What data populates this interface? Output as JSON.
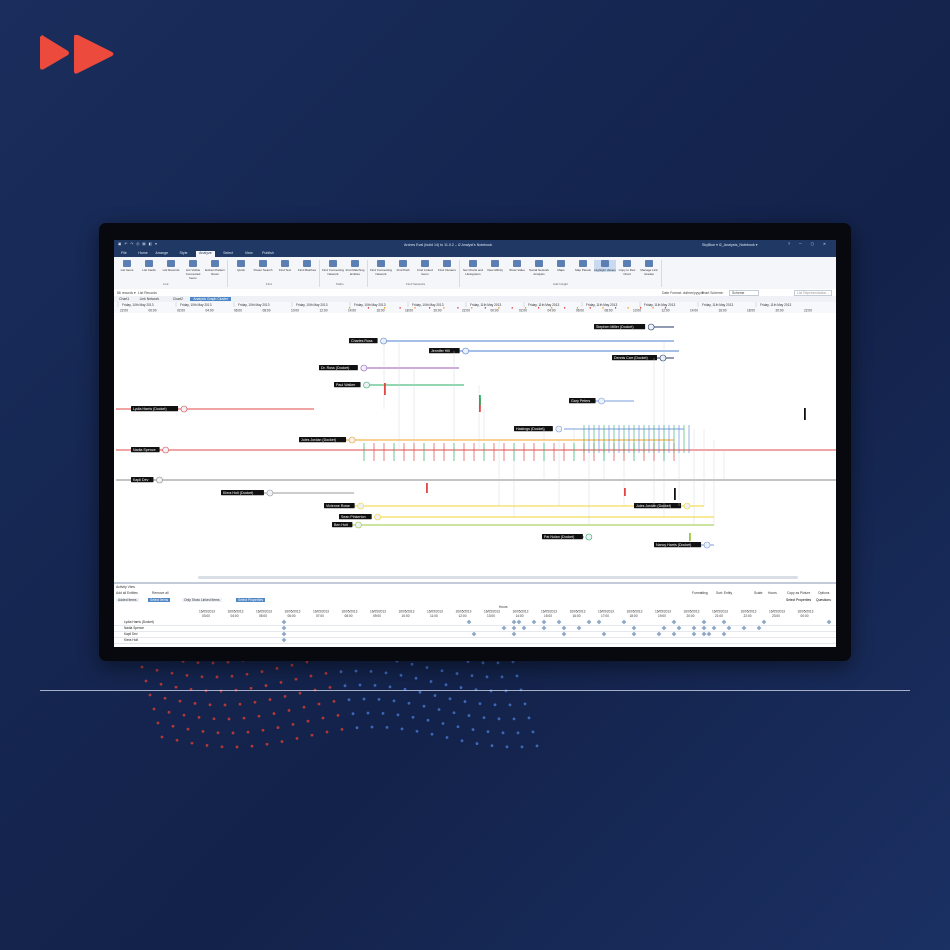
{
  "app": {
    "document_title": "Arches Eval (build 14) to 11.0.2 – i2 Analyst's Notebook",
    "user_area": "SkyBlue ▾ i2_Analysts_Notebook ▾",
    "qat_icons": [
      "save-icon",
      "undo-icon",
      "redo-icon",
      "print-icon"
    ],
    "menu": [
      "File",
      "Home",
      "Arrange",
      "Style",
      "Analyze",
      "Select",
      "View",
      "Publish"
    ],
    "active_menu": "Analyze"
  },
  "ribbon": {
    "groups": [
      {
        "label": "Link",
        "buttons": [
          "List Items",
          "List Cards",
          "List Records",
          "List Visible Connected Items",
          "Extract Pattern Rows"
        ]
      },
      {
        "label": "Find",
        "buttons": [
          "Quick",
          "Power Search",
          "Find Text",
          "Find Matches"
        ]
      },
      {
        "label": "Paths",
        "buttons": [
          "Find Connecting Network",
          "Find Matching Entities"
        ]
      },
      {
        "label": "Find Networks",
        "buttons": [
          "Find Connecting Network",
          "Find Path",
          "Find Linked Items",
          "Find Clusters"
        ]
      },
      {
        "label": "Add Insight",
        "buttons": [
          "Set Charts and Histograms",
          "View Affinity",
          "Show Value",
          "Social Network Analysis",
          "Maps",
          "Map Panels",
          "Highlight Values",
          "Copy to Flex Chart",
          "Manage Link Grades"
        ]
      }
    ],
    "active_button": "Highlight Values"
  },
  "filterbar": {
    "records": "86 records ▾",
    "list_records": "List Records",
    "date_format": "Date Format: dd/mm/yyyy ▾",
    "chart_scheme": "Chart Scheme:",
    "scheme_value": "Scheme",
    "search_placeholder": "List Representation..."
  },
  "chart_tabs": [
    "Chart1",
    "Link Network",
    "Chart2",
    "Analysis Graph Cluster"
  ],
  "active_chart_tab": 3,
  "timeline": {
    "days": [
      "Friday, 10th May 2013",
      "Friday, 10th May 2013",
      "Friday, 10th May 2013",
      "Friday, 10th May 2013",
      "Friday, 10th May 2013",
      "Friday, 10th May 2013",
      "Friday, 11th May 2013",
      "Friday, 11th May 2013",
      "Friday, 11th May 2013",
      "Friday, 11th May 2013",
      "Friday, 11th May 2013",
      "Friday, 11th May 2013"
    ],
    "hours": [
      "22:00",
      "00:00",
      "02:00",
      "04:00",
      "06:00",
      "08:00",
      "10:00",
      "12:00",
      "14:00",
      "16:00",
      "18:00",
      "20:00",
      "22:00",
      "00:00",
      "02:00",
      "04:00",
      "06:00",
      "08:00",
      "10:00",
      "12:00",
      "14:00",
      "16:00",
      "18:00",
      "20:00",
      "22:00"
    ]
  },
  "entities": [
    {
      "label": "Charles Ross",
      "color": "#4e7fd1"
    },
    {
      "label": "Jennifer Hill",
      "color": "#4e7fd1"
    },
    {
      "label": "Dr. Ross (Docket)",
      "color": "#9b59b6"
    },
    {
      "label": "Paul Walker",
      "color": "#27ae60"
    },
    {
      "label": "Lydia Harris (Docket)",
      "color": "#e04848"
    },
    {
      "label": "Nadia Spence",
      "color": "#e04848"
    },
    {
      "label": "Jules Jordan (Docket)",
      "color": "#f0a020"
    },
    {
      "label": "Hastings (Docket)",
      "color": "#7b9bd8"
    },
    {
      "label": "Kapil Dev",
      "color": "#888888"
    },
    {
      "label": "Kiera Holt (Docket)",
      "color": "#999999"
    },
    {
      "label": "Vivienne Rowe",
      "color": "#f2d430"
    },
    {
      "label": "Sean Pinkerton",
      "color": "#f2d430"
    },
    {
      "label": "Ben Holt",
      "color": "#9ac83c"
    },
    {
      "label": "Jules Jordan (Docket)",
      "color": "#f2d430"
    },
    {
      "label": "Stephen Miller (Docket)",
      "color": "#1f3964"
    },
    {
      "label": "Dennis Carr (Docket)",
      "color": "#1f3964"
    },
    {
      "label": "Gary Peters",
      "color": "#7b9bd8"
    },
    {
      "label": "Nancy Harris (Docket)",
      "color": "#7b9bd8"
    },
    {
      "label": "Pat Nolan (Docket)",
      "color": "#27ae60"
    }
  ],
  "activity_view": {
    "title": "Activity View",
    "add_all": "Add all Entities",
    "remove_all": "Remove all",
    "formatting": "Formatting",
    "sort": "Sort: Entity",
    "scale": "Scale:",
    "scale_value": "Hours",
    "copy_to_picture": "Copy as Picture",
    "options": "Options",
    "tabs": [
      "Added Items",
      "Select Items",
      "Only Show Linked Items",
      "Select Properties"
    ],
    "zoom_labels": [
      "Select Properties",
      "Questions"
    ],
    "hours_header": "Hours",
    "date_headers": [
      "16/05/2013",
      "16/05/2013",
      "16/05/2013",
      "16/05/2013",
      "16/05/2013",
      "16/05/2013",
      "16/05/2013",
      "16/05/2013",
      "16/05/2013",
      "16/05/2013",
      "16/05/2013",
      "16/05/2013",
      "16/05/2013",
      "16/05/2013",
      "16/05/2013",
      "16/05/2013",
      "16/05/2013",
      "16/05/2013",
      "16/05/2013",
      "16/05/2013",
      "16/05/2013",
      "16/05/2013"
    ],
    "hour_headers": [
      "03:00",
      "04:00",
      "05:00",
      "06:00",
      "07:00",
      "08:00",
      "09:00",
      "10:00",
      "11:00",
      "12:00",
      "13:00",
      "14:00",
      "15:00",
      "16:00",
      "17:00",
      "18:00",
      "19:00",
      "20:00",
      "21:00",
      "22:00",
      "23:00",
      "00:00"
    ],
    "rows": [
      "Lydia Harris (Docket)",
      "Nadia Spence",
      "Kapil Dev",
      "Kiera Holt"
    ]
  },
  "colors": {
    "accent": "#4f86c6",
    "titlebar": "#1f3964",
    "brand": "#e8402f",
    "background": "#152651"
  }
}
